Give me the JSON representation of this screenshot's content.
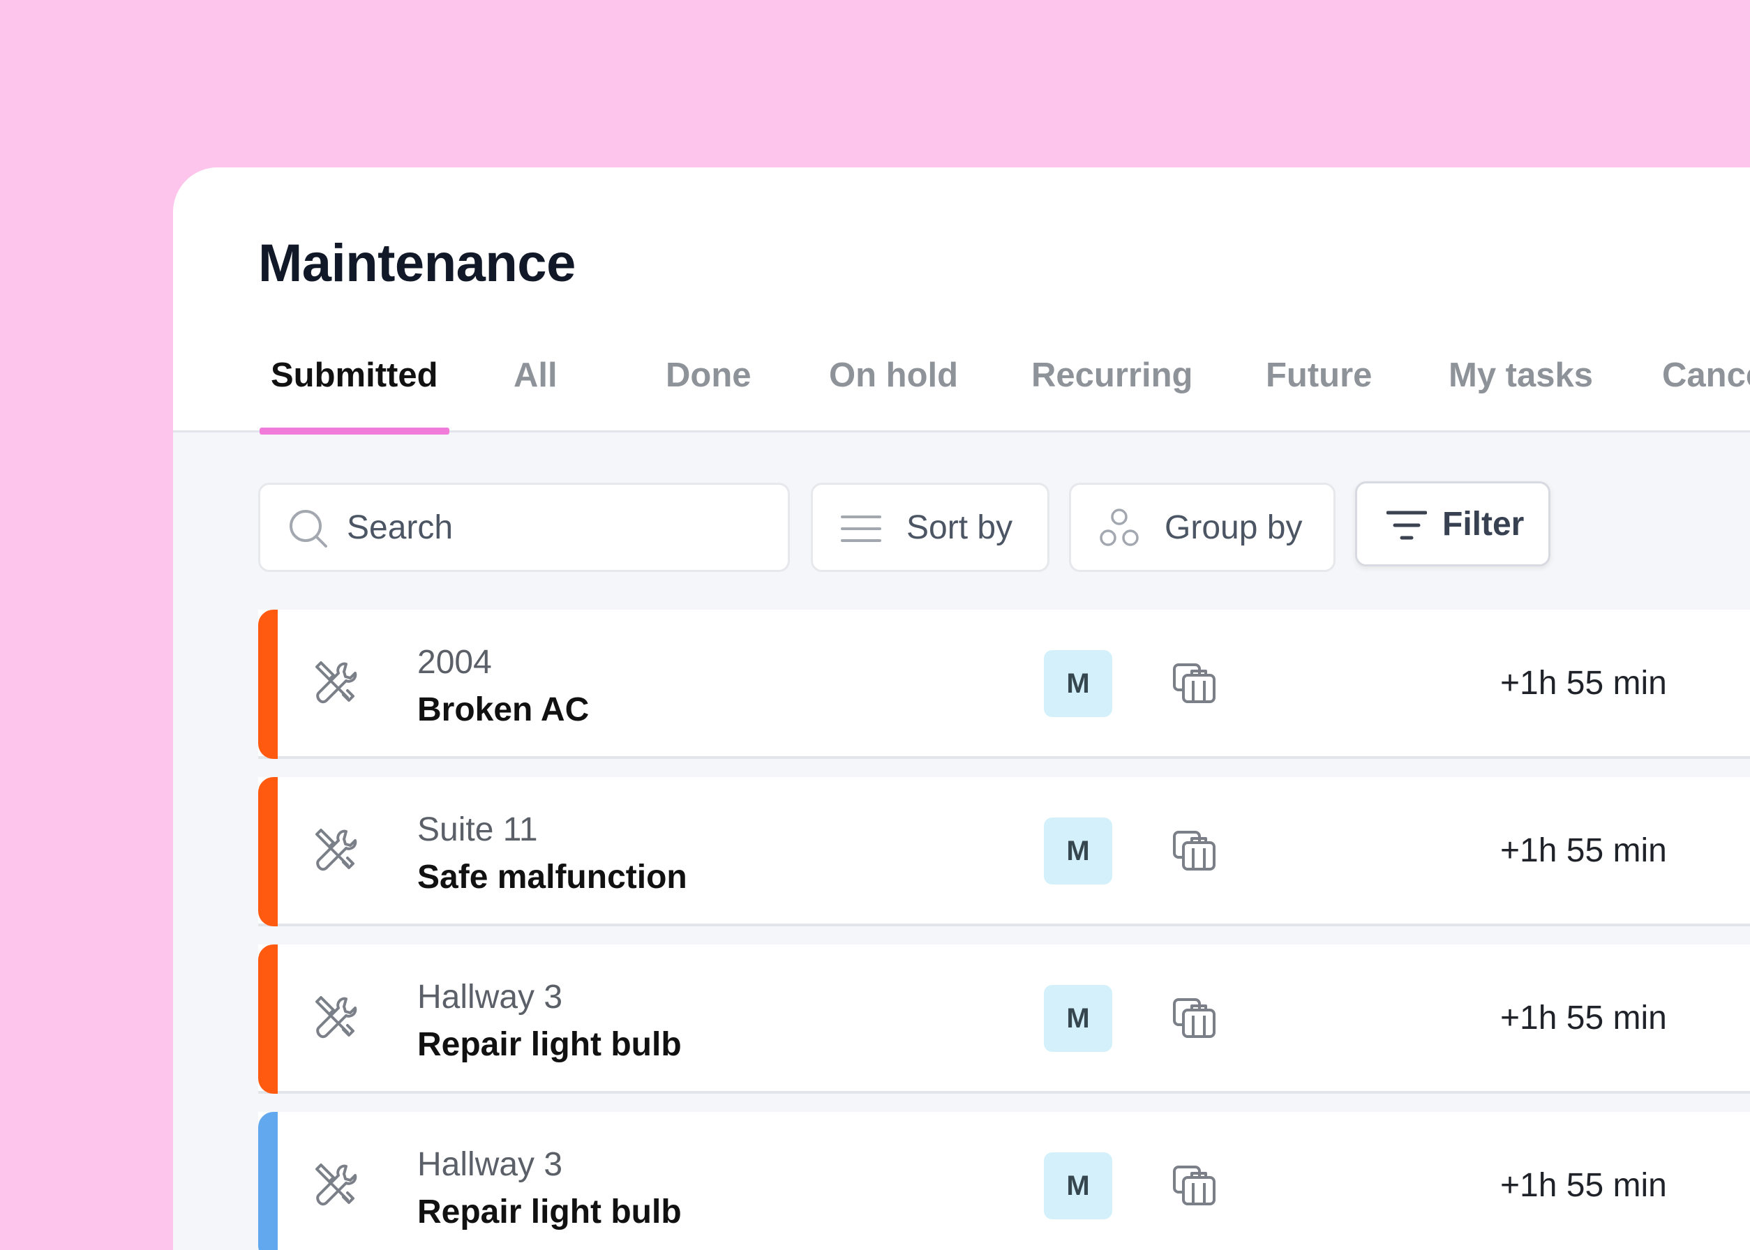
{
  "page": {
    "title": "Maintenance"
  },
  "tabs": [
    {
      "label": "Submitted",
      "active": true
    },
    {
      "label": "All",
      "active": false
    },
    {
      "label": "Done",
      "active": false
    },
    {
      "label": "On hold",
      "active": false
    },
    {
      "label": "Recurring",
      "active": false
    },
    {
      "label": "Future",
      "active": false
    },
    {
      "label": "My tasks",
      "active": false
    },
    {
      "label": "Cancelle",
      "active": false
    }
  ],
  "toolbar": {
    "search_placeholder": "Search",
    "sort_label": "Sort by",
    "group_label": "Group by",
    "filter_label": "Filter"
  },
  "rows": [
    {
      "location": "2004",
      "task": "Broken AC",
      "assignee": "M",
      "time": "+1h 55 min",
      "priority_color": "#FF5A0F",
      "icon": "wrench-screwdriver-icon",
      "dept_icon": "department-icon"
    },
    {
      "location": "Suite 11",
      "task": "Safe malfunction",
      "assignee": "M",
      "time": "+1h 55 min",
      "priority_color": "#FF5A0F",
      "icon": "wrench-screwdriver-icon",
      "dept_icon": "department-icon"
    },
    {
      "location": "Hallway 3",
      "task": "Repair light bulb",
      "assignee": "M",
      "time": "+1h 55 min",
      "priority_color": "#FF5A0F",
      "icon": "wrench-screwdriver-icon",
      "dept_icon": "department-icon"
    },
    {
      "location": "Hallway 3",
      "task": "Repair light bulb",
      "assignee": "M",
      "time": "+1h 55 min",
      "priority_color": "#62A8EE",
      "icon": "wrench-screwdriver-icon",
      "dept_icon": "department-icon"
    }
  ],
  "colors": {
    "background": "#FEC5EC",
    "active_tab_underline": "#F17BD8",
    "avatar_bg": "#D4F1FB"
  }
}
